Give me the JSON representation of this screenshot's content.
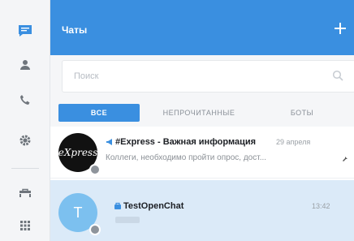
{
  "header": {
    "title": "Чаты",
    "add_icon": "plus-icon"
  },
  "search": {
    "placeholder": "Поиск",
    "icon": "search-icon"
  },
  "tabs": [
    {
      "label": "ВСЕ",
      "active": true
    },
    {
      "label": "НЕПРОЧИТАННЫЕ",
      "active": false
    },
    {
      "label": "БОТЫ",
      "active": false
    }
  ],
  "rail": {
    "items": [
      "chat-icon",
      "contacts-icon",
      "calls-icon",
      "settings-icon",
      "briefcase-icon",
      "apps-grid-icon"
    ]
  },
  "chats": [
    {
      "name": "#Express - Важная информация",
      "time": "29 апреля",
      "preview": "Коллеги, необходимо пройти опрос, дост...",
      "avatar_text": "eXpress",
      "type_icon": "channel-icon"
    },
    {
      "name": "TestOpenChat",
      "time": "13:42",
      "preview": "",
      "avatar_text": "T",
      "type_icon": "open-chat-icon"
    }
  ],
  "colors": {
    "accent": "#3a8fe0",
    "selected_row": "#dbeaf8",
    "rail_active": "#3a8fe0"
  }
}
